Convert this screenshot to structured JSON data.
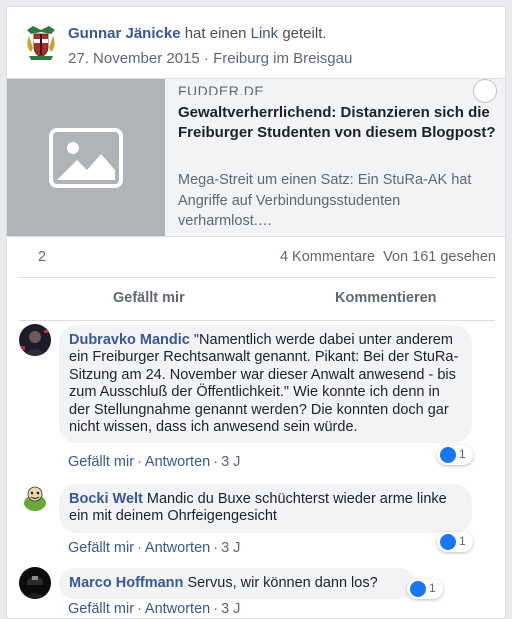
{
  "post": {
    "author": "Gunnar Jänicke",
    "verb": "hat einen",
    "link_word": "Link",
    "verb_end": "geteilt.",
    "date": "27. November 2015",
    "separator": "·",
    "location": "Freiburg im Breisgau"
  },
  "preview": {
    "source": "FUDDER.DE",
    "title": "Gewaltverherrlichend: Distanzieren sich die Freiburger Studenten von diesem Blogpost?",
    "description": "Mega-Streit um einen Satz: Ein StuRa-AK hat Angriffe auf Verbindungsstudenten verharmlost.…",
    "thumbnail_icon": "image-placeholder-icon"
  },
  "counts": {
    "likes": "2",
    "comments": "4 Kommentare",
    "views": "Von 161 gesehen"
  },
  "actions": {
    "like": "Gefällt mir",
    "comment": "Kommentieren"
  },
  "comments": [
    {
      "author": "Dubravko Mandic",
      "text": "\"Namentlich werde dabei unter anderem ein Freiburger Rechtsanwalt genannt. Pikant: Bei der StuRa-Sitzung am 24. November war dieser Anwalt anwesend - bis zum Ausschluß der Öffentlichkeit.\" Wie konnte ich denn in der Stellungnahme genannt werden? Die konnten doch gar nicht wissen, dass ich anwesend sein würde.",
      "like": "Gefällt mir",
      "reply": "Antworten",
      "age": "3 J",
      "reactions": "1"
    },
    {
      "author": "Bocki Welt",
      "text": "Mandic du Buxe schüchterst wieder arme linke ein mit deinem Ohrfeigengesicht",
      "like": "Gefällt mir",
      "reply": "Antworten",
      "age": "3 J",
      "reactions": "1"
    },
    {
      "author": "Marco Hoffmann",
      "text": "Servus, wir können dann los?",
      "like": "Gefällt mir",
      "reply": "Antworten",
      "age": "3 J",
      "reactions": "1"
    }
  ],
  "colors": {
    "link_blue": "#385898",
    "secondary_text": "#606770",
    "bubble_bg": "#f2f3f5",
    "like_blue": "#1877f2"
  }
}
